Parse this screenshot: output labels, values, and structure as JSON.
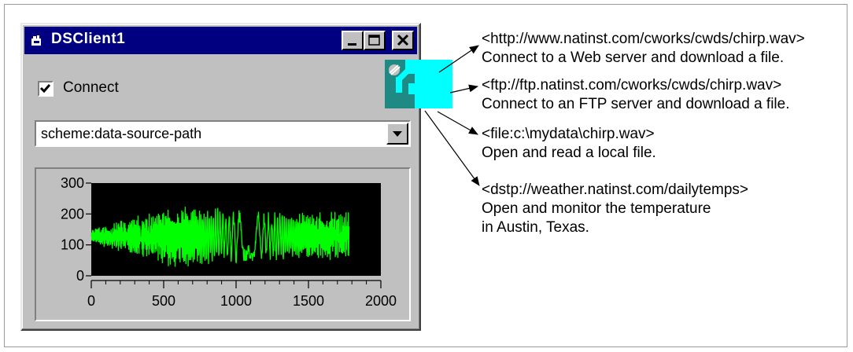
{
  "window": {
    "title": "DSClient1",
    "connect_label": "Connect",
    "connect_checked": true,
    "url_value": "scheme:data-source-path"
  },
  "chart_data": {
    "type": "line",
    "title": "",
    "xlabel": "",
    "ylabel": "",
    "xlim": [
      0,
      2000
    ],
    "ylim": [
      0,
      300
    ],
    "x_ticks": [
      "0",
      "500",
      "1000",
      "1500",
      "2000"
    ],
    "y_ticks": [
      "0",
      "100",
      "200",
      "300"
    ],
    "series": [
      {
        "color": "#00ff00",
        "x_range": [
          0,
          1780
        ],
        "center": 128,
        "amplitude_envelope": [
          {
            "x": 0,
            "amp": 25
          },
          {
            "x": 150,
            "amp": 45
          },
          {
            "x": 350,
            "amp": 70
          },
          {
            "x": 500,
            "amp": 100
          },
          {
            "x": 800,
            "amp": 95
          },
          {
            "x": 1100,
            "amp": 80
          },
          {
            "x": 1400,
            "amp": 75
          },
          {
            "x": 1780,
            "amp": 80
          }
        ]
      }
    ],
    "background": "#000000",
    "grid": false
  },
  "annotations": [
    {
      "url": "<http://www.natinst.com/cworks/cwds/chirp.wav>",
      "desc": "Connect to a Web server and download a file."
    },
    {
      "url": "<ftp://ftp.natinst.com/cworks/cwds/chirp.wav>",
      "desc": "Connect to an FTP server and download a file."
    },
    {
      "url": "<file:c:\\mydata\\chirp.wav>",
      "desc": "Open and read a local file."
    },
    {
      "url": "<dstp://weather.natinst.com/dailytemps>",
      "desc": "Open and monitor the temperature",
      "desc2": "in Austin, Texas."
    }
  ],
  "colors": {
    "title_bar": "#000080",
    "window_face": "#c0c0c0",
    "icon_teal": "#1f8a84",
    "icon_cyan": "#00ffff",
    "plot_trace": "#00ff00"
  }
}
